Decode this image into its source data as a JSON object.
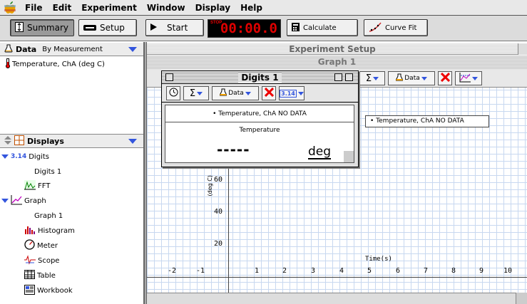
{
  "menubar": {
    "items": [
      "File",
      "Edit",
      "Experiment",
      "Window",
      "Display",
      "Help"
    ]
  },
  "toolbar": {
    "summary_label": "Summary",
    "setup_label": "Setup",
    "start_label": "Start",
    "timer_stop": "STOP",
    "timer_value": "00:00.0",
    "calculate_label": "Calculate",
    "curve_fit_label": "Curve Fit"
  },
  "data_panel": {
    "title": "Data",
    "mode": "By Measurement",
    "items": [
      "Temperature, ChA (deg C)"
    ]
  },
  "displays_panel": {
    "title": "Displays",
    "items": [
      {
        "label": "Digits",
        "icon": "digits-icon",
        "expanded": true,
        "prefix": "3.14"
      },
      {
        "label": "Digits 1",
        "child": true
      },
      {
        "label": "FFT",
        "icon": "fft-icon"
      },
      {
        "label": "Graph",
        "icon": "graph-icon",
        "expanded": true
      },
      {
        "label": "Graph 1",
        "child": true
      },
      {
        "label": "Histogram",
        "icon": "histogram-icon"
      },
      {
        "label": "Meter",
        "icon": "meter-icon"
      },
      {
        "label": "Scope",
        "icon": "scope-icon"
      },
      {
        "label": "Table",
        "icon": "table-icon"
      },
      {
        "label": "Workbook",
        "icon": "workbook-icon"
      }
    ]
  },
  "experiment_setup": {
    "title": "Experiment Setup"
  },
  "graph_window": {
    "title": "Graph 1",
    "data_button": "Data",
    "legend": "Temperature, ChA NO DATA",
    "y_label": "(deg C)",
    "y_ticks": [
      "60",
      "40",
      "20"
    ],
    "x_label": "Time(s)",
    "x_ticks": [
      "-2",
      "-1",
      "1",
      "2",
      "3",
      "4",
      "5",
      "6",
      "7",
      "8",
      "9",
      "10"
    ]
  },
  "digits_window": {
    "title": "Digits 1",
    "data_button": "Data",
    "digits_icon": "3.14",
    "source": "Temperature, ChA   NO DATA",
    "measurement": "Temperature",
    "value": "-----",
    "unit": "deg"
  }
}
